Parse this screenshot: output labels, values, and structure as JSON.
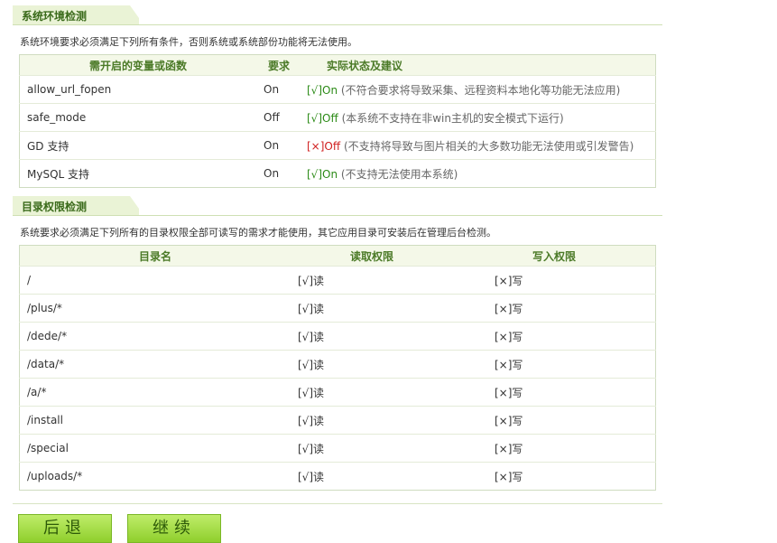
{
  "env": {
    "title": "系统环境检测",
    "desc": "系统环境要求必须满足下列所有条件，否则系统或系统部份功能将无法使用。",
    "headers": [
      "需开启的变量或函数",
      "要求",
      "实际状态及建议"
    ],
    "rows": [
      {
        "name": "allow_url_fopen",
        "req": "On",
        "status": "[√]On",
        "status_ok": true,
        "note": "(不符合要求将导致采集、远程资料本地化等功能无法应用)"
      },
      {
        "name": "safe_mode",
        "req": "Off",
        "status": "[√]Off",
        "status_ok": true,
        "note": "(本系统不支持在非win主机的安全模式下运行)"
      },
      {
        "name": "GD 支持",
        "req": "On",
        "status": "[×]Off",
        "status_ok": false,
        "note": "(不支持将导致与图片相关的大多数功能无法使用或引发警告)"
      },
      {
        "name": "MySQL 支持",
        "req": "On",
        "status": "[√]On",
        "status_ok": true,
        "note": "(不支持无法使用本系统)"
      }
    ]
  },
  "dirs": {
    "title": "目录权限检测",
    "desc": "系统要求必须满足下列所有的目录权限全部可读写的需求才能使用，其它应用目录可安装后在管理后台检测。",
    "headers": [
      "目录名",
      "读取权限",
      "写入权限"
    ],
    "rows": [
      {
        "path": "/",
        "read": "[√]读",
        "write": "[×]写"
      },
      {
        "path": "/plus/*",
        "read": "[√]读",
        "write": "[×]写"
      },
      {
        "path": "/dede/*",
        "read": "[√]读",
        "write": "[×]写"
      },
      {
        "path": "/data/*",
        "read": "[√]读",
        "write": "[×]写"
      },
      {
        "path": "/a/*",
        "read": "[√]读",
        "write": "[×]写"
      },
      {
        "path": "/install",
        "read": "[√]读",
        "write": "[×]写"
      },
      {
        "path": "/special",
        "read": "[√]读",
        "write": "[×]写"
      },
      {
        "path": "/uploads/*",
        "read": "[√]读",
        "write": "[×]写"
      }
    ]
  },
  "buttons": {
    "back": "后退",
    "next": "继续"
  }
}
